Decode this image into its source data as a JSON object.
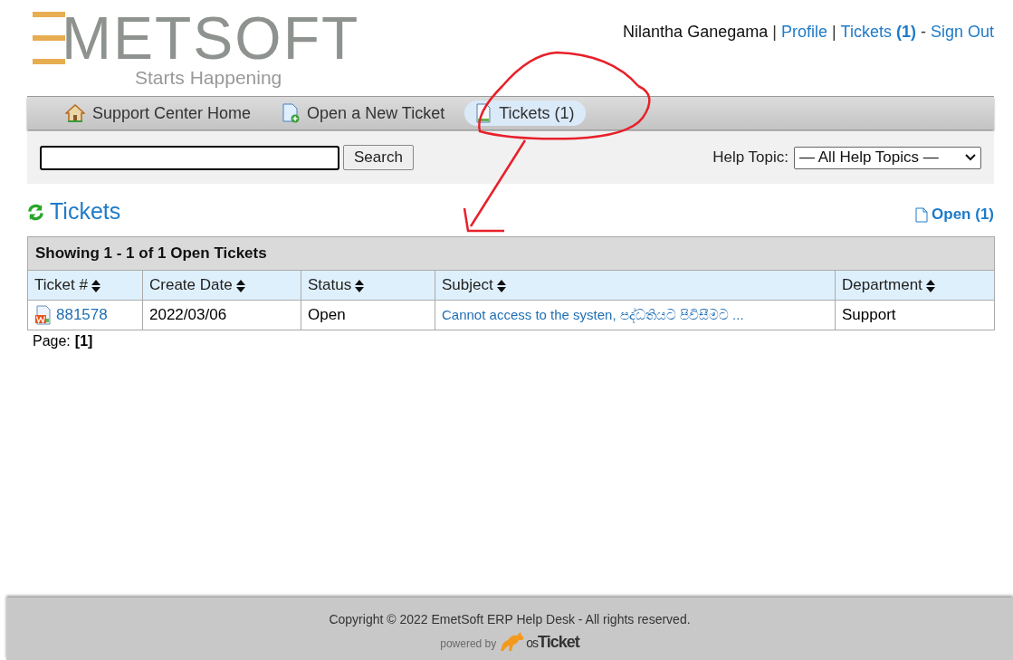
{
  "logo": {
    "text": "METSOFT",
    "tagline": "Starts Happening"
  },
  "user_bar": {
    "name": "Nilantha Ganegama",
    "separator_1": "|",
    "profile": "Profile",
    "separator_2": "|",
    "tickets": "Tickets **(1)**",
    "separator_3": "-",
    "sign_out": "Sign Out"
  },
  "nav": [
    {
      "label": "Support Center Home",
      "selected": false
    },
    {
      "label": "Open a New Ticket",
      "selected": false
    },
    {
      "label": "Tickets (1)",
      "selected": true
    }
  ],
  "search": {
    "button": "Search",
    "help_topic_label": "Help Topic:",
    "help_topic_value": "— All Help Topics —"
  },
  "heading": "Tickets",
  "open_link": "Open (1)",
  "table": {
    "caption": "Showing 1 - 1 of 1 Open Tickets",
    "columns": [
      "Ticket #",
      "Create Date",
      "Status",
      "Subject",
      "Department"
    ],
    "rows": [
      {
        "ticket": "881578",
        "date": "2022/03/06",
        "status": "Open",
        "subject": "Cannot access to the systen, පද්ධතියට පිවිසීමට ...",
        "department": "Support"
      }
    ]
  },
  "pager": {
    "label": "Page:",
    "current": "[1]"
  },
  "footer": {
    "copyright": "Copyright © 2022 EmetSoft ERP Help Desk - All rights reserved.",
    "powered_by": "powered by",
    "brand_os": "os",
    "brand_ticket": "Ticket"
  }
}
